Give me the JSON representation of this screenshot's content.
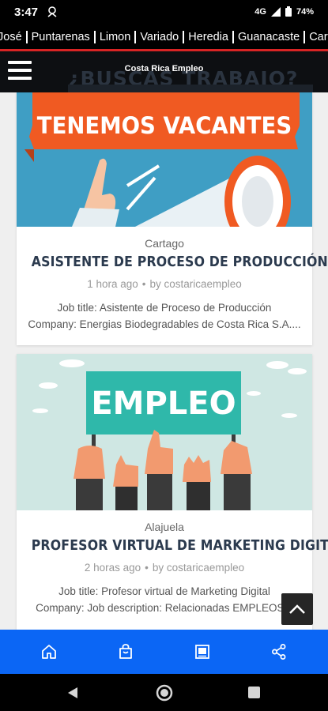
{
  "status_bar": {
    "time": "3:47",
    "network": "4G",
    "battery": "74%"
  },
  "ticker": {
    "items": [
      "José",
      "Puntarenas",
      "Limon",
      "Variado",
      "Heredia",
      "Guanacaste",
      "Cart"
    ]
  },
  "header": {
    "title": "Costa Rica Empleo",
    "background_text": "¿BUSCAS TRABAJO?"
  },
  "posts": [
    {
      "image_text": "TENEMOS VACANTES",
      "region": "Cartago",
      "title": "ASISTENTE DE PROCESO DE PRODUCCIÓN",
      "time": "1 hora ago",
      "author": "by costaricaempleo",
      "excerpt_line1": "Job title: Asistente de Proceso de Producción",
      "excerpt_line2": "Company: Energias Biodegradables de Costa Rica S.A...."
    },
    {
      "image_text": "EMPLEO",
      "region": "Alajuela",
      "title": "PROFESOR VIRTUAL DE MARKETING DIGITAL",
      "time": "2 horas ago",
      "author": "by costaricaempleo",
      "excerpt_line1": "Job title: Profesor virtual de Marketing Digital",
      "excerpt_line2": "Company: Job description: Relacionadas EMPLEOS..."
    }
  ],
  "bottom_nav": {
    "icons": [
      "home-icon",
      "shopping-bag-icon",
      "document-icon",
      "share-icon"
    ]
  },
  "colors": {
    "accent_blue": "#0b66f5",
    "ticker_red_line": "#d82424",
    "title_navy": "#2b3a4e",
    "vacantes_orange": "#f05a22",
    "empleo_teal": "#2fb8aa"
  }
}
